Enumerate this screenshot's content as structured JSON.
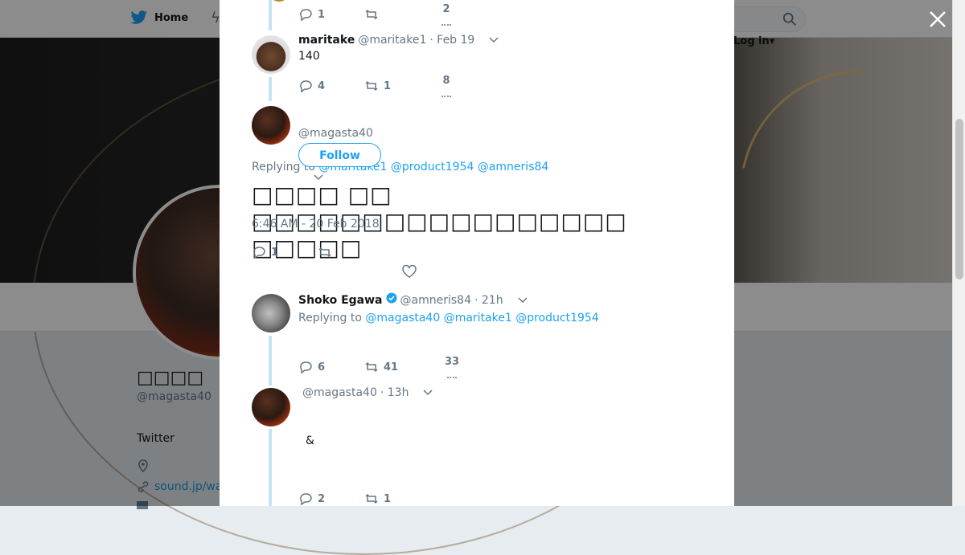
{
  "background": {
    "nav": {
      "home_label": "Home",
      "login_label": "Log in"
    },
    "profile": {
      "name": "□□□□",
      "handle": "@magasta40",
      "bio_label": "Twitter",
      "link_text": "sound.jp/wa"
    }
  },
  "modal": {
    "top_tweet": {
      "reply_count": "1",
      "retweet_count": "",
      "like_count": "2"
    },
    "tweet_maritake": {
      "name": "maritake",
      "handle": "@maritake1",
      "time": "· Feb 19",
      "text": "140",
      "reply_count": "4",
      "retweet_count": "1",
      "like_count": "8"
    },
    "main_tweet": {
      "handle": "@magasta40",
      "follow_label": "Follow",
      "replying_prefix": "Replying to",
      "replying_to": [
        "@maritake1",
        "@product1954",
        "@amneris84"
      ],
      "text": "□□□□ □□ □□□□□□□□□□□□□□□□□ □□□□□",
      "timestamp": "6:46 AM - 20 Feb 2018",
      "reply_count": "1"
    },
    "tweet_shoko": {
      "name": "Shoko Egawa",
      "handle": "@amneris84",
      "time": "· 21h",
      "replying_prefix": "Replying to",
      "replying_to": [
        "@magasta40",
        "@maritake1",
        "@product1954"
      ],
      "reply_count": "6",
      "retweet_count": "41",
      "like_count": "33"
    },
    "tweet_magasta": {
      "handle": "@magasta40",
      "time": "· 13h",
      "text": "&",
      "reply_count": "2",
      "retweet_count": "1"
    }
  },
  "colors": {
    "link": "#1da1f2",
    "thread_line": "#c4e3f5",
    "muted": "#657786"
  }
}
